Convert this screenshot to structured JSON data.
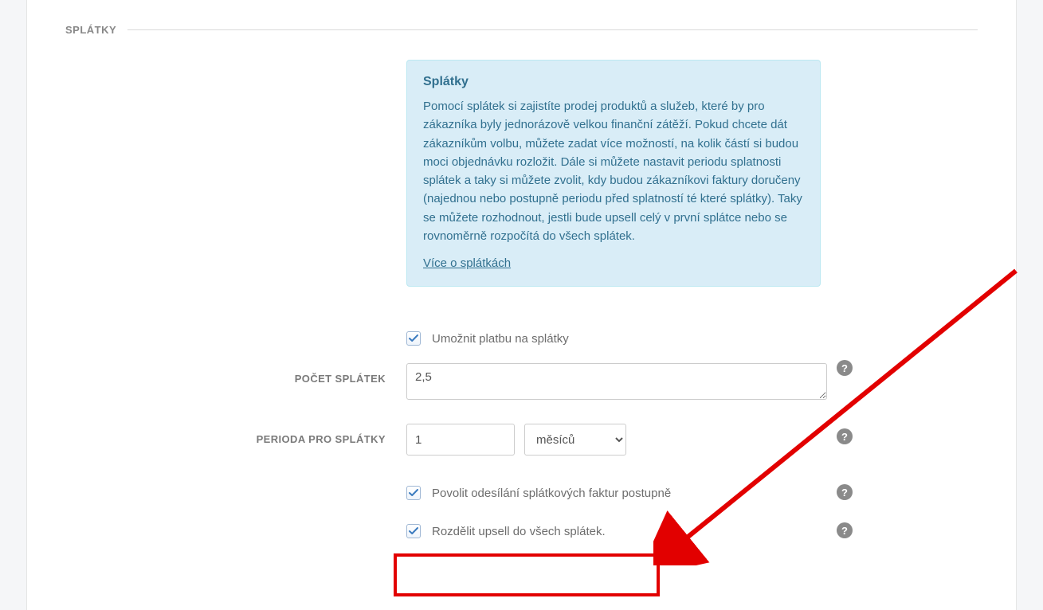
{
  "section": {
    "title": "SPLÁTKY"
  },
  "info": {
    "title": "Splátky",
    "text": "Pomocí splátek si zajistíte prodej produktů a služeb, které by pro zákazníka byly jednorázově velkou finanční zátěží. Pokud chcete dát zákazníkům volbu, můžete zadat více možností, na kolik částí si budou moci objednávku rozložit. Dále si můžete nastavit periodu splatnosti splátek a taky si můžete zvolit, kdy budou zákazníkovi faktury doručeny (najednou nebo postupně periodu před splatností té které splátky). Taky se můžete rozhodnout, jestli bude upsell celý v první splátce nebo se rovnoměrně rozpočítá do všech splátek.",
    "link": "Více o splátkách"
  },
  "enable": {
    "label": "Umožnit platbu na splátky",
    "checked": true
  },
  "count": {
    "label": "POČET SPLÁTEK",
    "value": "2,5"
  },
  "period": {
    "label": "PERIODA PRO SPLÁTKY",
    "value": "1",
    "unit": "měsíců",
    "options": [
      "měsíců"
    ]
  },
  "gradual": {
    "label": "Povolit odesílání splátkových faktur postupně",
    "checked": true
  },
  "split_upsell": {
    "label": "Rozdělit upsell do všech splátek.",
    "checked": true
  },
  "help_glyph": "?"
}
